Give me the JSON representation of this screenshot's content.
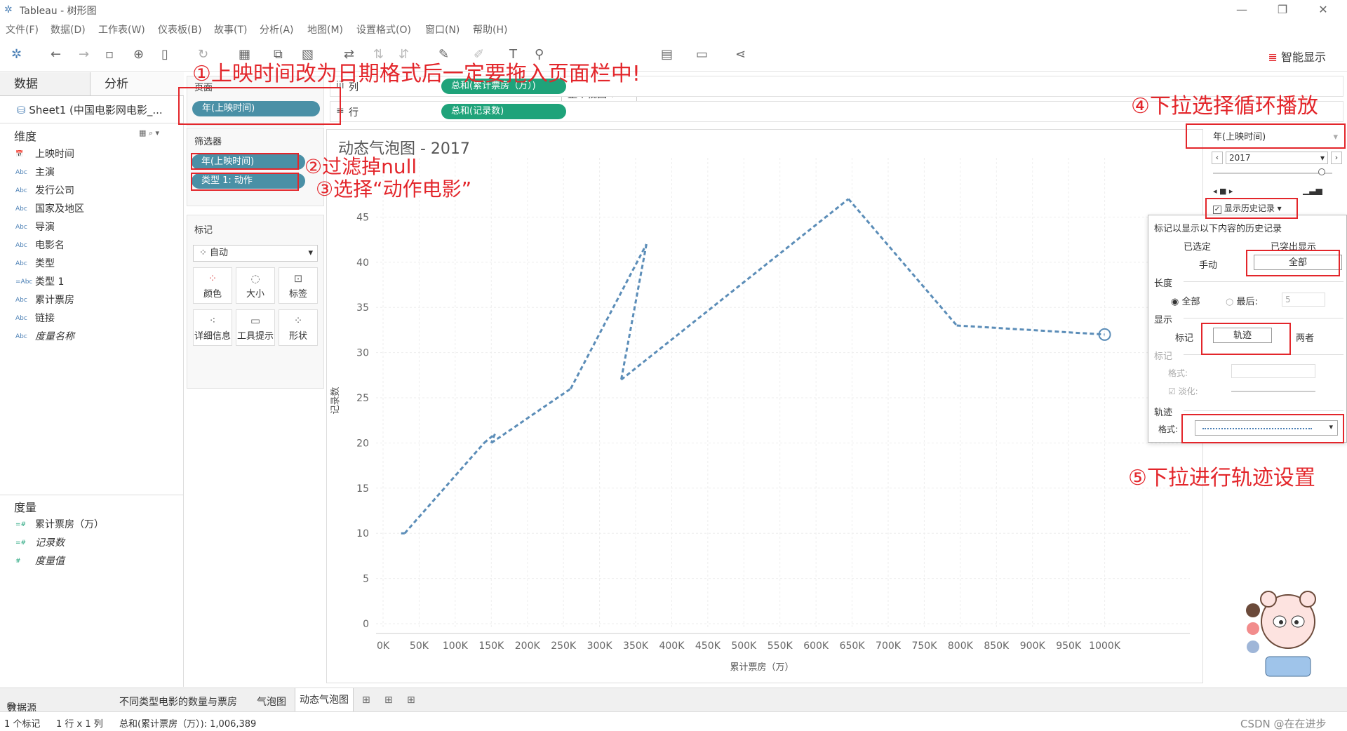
{
  "window": {
    "title": "Tableau - 树形图",
    "minimize": "—",
    "restore": "❐",
    "close": "✕"
  },
  "menu": [
    "文件(F)",
    "数据(D)",
    "工作表(W)",
    "仪表板(B)",
    "故事(T)",
    "分析(A)",
    "地图(M)",
    "设置格式(O)",
    "窗口(N)",
    "帮助(H)"
  ],
  "toolbar": {
    "view_select": "整个视图",
    "smart_show": "智能显示"
  },
  "left": {
    "tab_data": "数据",
    "tab_analysis": "分析",
    "datasource": "Sheet1 (中国电影网电影_...",
    "dimensions_title": "维度",
    "dimensions": [
      {
        "icon": "📅",
        "label": "上映时间"
      },
      {
        "icon": "Abc",
        "label": "主演"
      },
      {
        "icon": "Abc",
        "label": "发行公司"
      },
      {
        "icon": "Abc",
        "label": "国家及地区"
      },
      {
        "icon": "Abc",
        "label": "导演"
      },
      {
        "icon": "Abc",
        "label": "电影名"
      },
      {
        "icon": "Abc",
        "label": "类型"
      },
      {
        "icon": "=Abc",
        "label": "类型 1"
      },
      {
        "icon": "Abc",
        "label": "累计票房"
      },
      {
        "icon": "Abc",
        "label": "链接"
      },
      {
        "icon": "Abc",
        "label": "度量名称"
      }
    ],
    "measures_title": "度量",
    "measures": [
      {
        "icon": "=#",
        "label": "累计票房（万）"
      },
      {
        "icon": "=#",
        "label": "记录数"
      },
      {
        "icon": "#",
        "label": "度量值"
      }
    ]
  },
  "shelves": {
    "pages_title": "页面",
    "pages_pill": "年(上映时间)",
    "columns_label": "列",
    "columns_pill": "总和(累计票房（万）)",
    "rows_label": "行",
    "rows_pill": "总和(记录数)",
    "filters_title": "筛选器",
    "filter_pills": [
      "年(上映时间)",
      "类型 1: 动作"
    ],
    "marks_title": "标记",
    "marks_type": "自动",
    "marks_buttons": [
      {
        "icon": "color-icon",
        "label": "颜色"
      },
      {
        "icon": "size-icon",
        "label": "大小"
      },
      {
        "icon": "label-icon",
        "label": "标签"
      },
      {
        "icon": "detail-icon",
        "label": "详细信息"
      },
      {
        "icon": "tooltip-icon",
        "label": "工具提示"
      },
      {
        "icon": "shape-icon",
        "label": "形状"
      }
    ]
  },
  "annotations": {
    "a1": "①上映时间改为日期格式后一定要拖入页面栏中!",
    "a2": "②过滤掉null",
    "a3": "③选择“动作电影”",
    "a4": "④下拉选择循环播放",
    "a5": "⑤下拉进行轨迹设置"
  },
  "chart_data": {
    "type": "line",
    "title": "动态气泡图 - 2017",
    "xlabel": "累计票房（万）",
    "ylabel": "记录数",
    "xlim": [
      0,
      1050000
    ],
    "ylim": [
      0,
      50
    ],
    "xticks": [
      "0K",
      "50K",
      "100K",
      "150K",
      "200K",
      "250K",
      "300K",
      "350K",
      "400K",
      "450K",
      "500K",
      "550K",
      "600K",
      "650K",
      "700K",
      "750K",
      "800K",
      "850K",
      "900K",
      "950K",
      "1000K"
    ],
    "yticks": [
      0,
      5,
      10,
      15,
      20,
      25,
      30,
      35,
      40,
      45
    ],
    "grid": true,
    "line_style": "dashed",
    "series_color": "#5b8db8",
    "points": [
      [
        25000,
        10
      ],
      [
        30000,
        10
      ],
      [
        140000,
        20
      ],
      [
        155000,
        21
      ],
      [
        150000,
        20
      ],
      [
        260000,
        26
      ],
      [
        365000,
        42
      ],
      [
        330000,
        27
      ],
      [
        645000,
        47
      ],
      [
        795000,
        33
      ],
      [
        1000000,
        32
      ]
    ]
  },
  "right": {
    "page_field": "年(上映时间)",
    "year": "2017",
    "show_history": "显示历史记录",
    "history": {
      "header": "标记以显示以下内容的历史记录",
      "selected": "已选定",
      "highlighted": "已突出显示",
      "manual": "手动",
      "all_btn": "全部",
      "length": "长度",
      "length_all": "全部",
      "length_last": "最后:",
      "last_value": "5",
      "display": "显示",
      "disp_marks": "标记",
      "disp_trail": "轨迹",
      "disp_both": "两者",
      "marks_sec": "标记",
      "format_label": "格式:",
      "fade_label": "淡化:",
      "trail_sec": "轨迹",
      "trail_format": "格式:"
    }
  },
  "tabs": [
    "数据源",
    "不同类型电影的数量与票房",
    "气泡图",
    "动态气泡图"
  ],
  "status": {
    "marks": "1 个标记",
    "rowscols": "1 行 x 1 列",
    "sum": "总和(累计票房（万）): 1,006,389"
  },
  "watermark": "CSDN @在在进步"
}
